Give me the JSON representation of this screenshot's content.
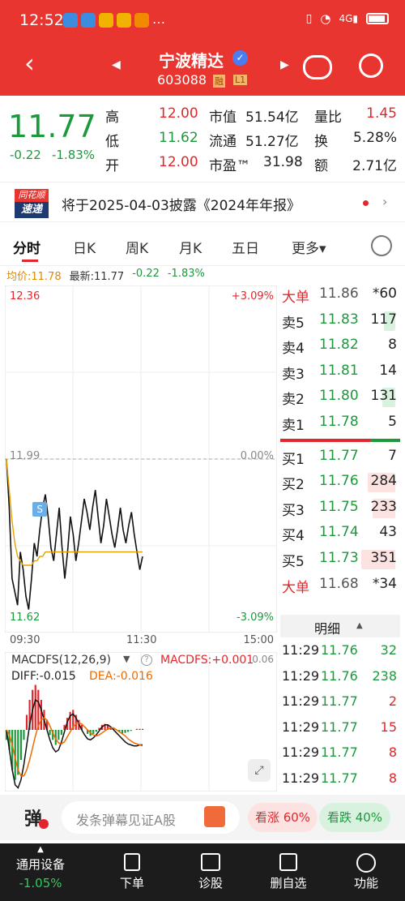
{
  "status": {
    "time": "12:52",
    "notif_icons": [
      "wechat-icon",
      "app-icon",
      "message-icon",
      "app2-icon",
      "app3-icon"
    ],
    "more": "…",
    "right_icons": [
      "vibrate-icon",
      "wifi-icon",
      "signal-4g-icon",
      "battery-icon"
    ]
  },
  "header": {
    "stock_name": "宁波精达",
    "verified_icon": "verified-check-icon",
    "stock_code": "603088",
    "badge_margin": "融",
    "badge_level": "L1",
    "back_icon": "back-arrow-icon",
    "prev_icon": "prev-stock-icon",
    "next_icon": "next-stock-icon",
    "robot_icon": "robot-icon",
    "search_icon": "search-icon"
  },
  "quote": {
    "price": "11.77",
    "change": "-0.22",
    "change_pct": "-1.83%",
    "labels": {
      "high": "高",
      "low": "低",
      "open": "开",
      "mkt_cap": "市值",
      "float_cap": "流通",
      "pe": "市盈™",
      "vol_ratio": "量比",
      "turnover": "换",
      "amount": "额"
    },
    "values": {
      "high": "12.00",
      "low": "11.62",
      "open": "12.00",
      "mkt_cap": "51.54亿",
      "float_cap": "51.27亿",
      "pe": "31.98",
      "vol_ratio": "1.45",
      "turnover": "5.28%",
      "amount": "2.71亿"
    }
  },
  "news": {
    "logo_top": "同花顺",
    "logo_bottom": "速递",
    "text": "将于2025-04-03披露《2024年年报》"
  },
  "tabs": [
    "分时",
    "日K",
    "周K",
    "月K",
    "五日",
    "更多▾"
  ],
  "tabs_active": 0,
  "chart_info": {
    "avg_label": "均价:11.78",
    "latest_label": "最新:11.77",
    "change": "-0.22",
    "change_pct": "-1.83%"
  },
  "chart_data": [
    {
      "type": "line",
      "title": "",
      "y_left_ticks": [
        "12.36",
        "11.99",
        "11.62"
      ],
      "y_right_ticks": [
        "+3.09%",
        "0.00%",
        "-3.09%"
      ],
      "x_ticks": [
        "09:30",
        "11:30",
        "15:00"
      ],
      "ylim": [
        11.62,
        12.36
      ],
      "reference": 11.99,
      "marker": "S",
      "series": [
        {
          "name": "",
          "values": [
            11.99,
            11.88,
            11.72,
            11.69,
            11.66,
            11.78,
            11.74,
            11.68,
            11.65,
            11.72,
            11.8,
            11.77,
            11.83,
            11.88,
            11.91,
            11.86,
            11.79,
            11.76,
            11.82,
            11.88,
            11.79,
            11.72,
            11.78,
            11.86,
            11.82,
            11.76,
            11.8,
            11.85,
            11.9,
            11.87,
            11.83,
            11.88,
            11.92,
            11.86,
            11.8,
            11.84,
            11.9,
            11.86,
            11.82,
            11.79,
            11.83,
            11.88,
            11.83,
            11.8,
            11.84,
            11.87,
            11.82,
            11.78,
            11.74,
            11.77
          ]
        },
        {
          "name": "",
          "values": [
            11.99,
            11.92,
            11.85,
            11.8,
            11.77,
            11.76,
            11.75,
            11.75,
            11.75,
            11.75,
            11.76,
            11.76,
            11.77,
            11.77,
            11.78,
            11.78,
            11.78,
            11.78,
            11.78,
            11.78,
            11.78,
            11.78,
            11.78,
            11.78,
            11.78,
            11.78,
            11.78,
            11.78,
            11.78,
            11.78,
            11.78,
            11.78,
            11.78,
            11.78,
            11.78,
            11.78,
            11.78,
            11.78,
            11.78,
            11.78,
            11.78,
            11.78,
            11.78,
            11.78,
            11.78,
            11.78,
            11.78,
            11.78,
            11.78,
            11.78
          ]
        }
      ]
    },
    {
      "type": "bar",
      "title": "MACDFS(12,26,9)",
      "ylim": [
        -0.06,
        0.06
      ],
      "right_tick": "0.06",
      "values": [
        -0.01,
        -0.02,
        -0.04,
        -0.05,
        -0.045,
        -0.03,
        -0.01,
        0.015,
        0.03,
        0.04,
        0.045,
        0.04,
        0.03,
        0.02,
        0.01,
        -0.005,
        -0.01,
        -0.015,
        -0.01,
        -0.005,
        0.005,
        0.012,
        0.018,
        0.02,
        0.015,
        0.01,
        0.005,
        0.0,
        -0.004,
        -0.006,
        -0.004,
        -0.002,
        0.002,
        0.005,
        0.006,
        0.005,
        0.003,
        0.001,
        0.0,
        -0.002,
        -0.004,
        -0.003,
        -0.002,
        -0.001,
        0.0,
        0.001,
        0.001,
        0.001
      ],
      "series": [
        {
          "name": "DIFF",
          "values": [
            0.0,
            -0.02,
            -0.04,
            -0.055,
            -0.058,
            -0.05,
            -0.035,
            -0.015,
            0.005,
            0.02,
            0.03,
            0.028,
            0.02,
            0.01,
            0.0,
            -0.01,
            -0.018,
            -0.022,
            -0.02,
            -0.012,
            -0.002,
            0.008,
            0.014,
            0.016,
            0.012,
            0.006,
            0.0,
            -0.005,
            -0.009,
            -0.01,
            -0.008,
            -0.005,
            -0.001,
            0.003,
            0.005,
            0.005,
            0.003,
            0.0,
            -0.003,
            -0.006,
            -0.009,
            -0.012,
            -0.014,
            -0.015,
            -0.016,
            -0.016,
            -0.015,
            -0.015
          ]
        },
        {
          "name": "DEA",
          "values": [
            0.0,
            -0.005,
            -0.015,
            -0.028,
            -0.04,
            -0.046,
            -0.046,
            -0.04,
            -0.03,
            -0.018,
            -0.006,
            0.004,
            0.01,
            0.012,
            0.01,
            0.004,
            -0.003,
            -0.009,
            -0.013,
            -0.014,
            -0.012,
            -0.007,
            -0.002,
            0.003,
            0.006,
            0.007,
            0.006,
            0.003,
            0.0,
            -0.003,
            -0.005,
            -0.006,
            -0.005,
            -0.003,
            -0.001,
            0.001,
            0.002,
            0.002,
            0.0,
            -0.002,
            -0.004,
            -0.006,
            -0.009,
            -0.011,
            -0.013,
            -0.014,
            -0.015,
            -0.016
          ]
        }
      ]
    }
  ],
  "macd": {
    "title": "MACDFS(12,26,9)",
    "macdfs_label": "MACDFS:+0.001",
    "diff_label": "DIFF:-0.015",
    "dea_label": "DEA:-0.016"
  },
  "orderbook": {
    "big_sell": {
      "label": "大单",
      "price": "11.86",
      "vol": "*60"
    },
    "asks": [
      {
        "label": "卖5",
        "price": "11.83",
        "vol": "117",
        "ratio": 0.33
      },
      {
        "label": "卖4",
        "price": "11.82",
        "vol": "8",
        "ratio": 0.0
      },
      {
        "label": "卖3",
        "price": "11.81",
        "vol": "14",
        "ratio": 0.0
      },
      {
        "label": "卖2",
        "price": "11.80",
        "vol": "131",
        "ratio": 0.37
      },
      {
        "label": "卖1",
        "price": "11.78",
        "vol": "5",
        "ratio": 0.0
      }
    ],
    "bids": [
      {
        "label": "买1",
        "price": "11.77",
        "vol": "7",
        "ratio": 0.0
      },
      {
        "label": "买2",
        "price": "11.76",
        "vol": "284",
        "ratio": 0.81
      },
      {
        "label": "买3",
        "price": "11.75",
        "vol": "233",
        "ratio": 0.66
      },
      {
        "label": "买4",
        "price": "11.74",
        "vol": "43",
        "ratio": 0.0
      },
      {
        "label": "买5",
        "price": "11.73",
        "vol": "351",
        "ratio": 1.0
      }
    ],
    "big_buy": {
      "label": "大单",
      "price": "11.68",
      "vol": "*34"
    }
  },
  "details": {
    "title": "明细",
    "rows": [
      {
        "time": "11:29",
        "price": "11.76",
        "vol": "32"
      },
      {
        "time": "11:29",
        "price": "11.76",
        "vol": "238"
      },
      {
        "time": "11:29",
        "price": "11.77",
        "vol": "2"
      },
      {
        "time": "11:29",
        "price": "11.77",
        "vol": "15"
      },
      {
        "time": "11:29",
        "price": "11.77",
        "vol": "8"
      },
      {
        "time": "11:29",
        "price": "11.77",
        "vol": "8"
      }
    ]
  },
  "danmu": {
    "icon_text": "弹",
    "placeholder": "发条弹幕见证A股",
    "up_label": "看涨 60%",
    "down_label": "看跌 40%",
    "up_pct": 60
  },
  "bottom": {
    "device_label": "通用设备",
    "device_change": "-1.05%",
    "order": "下单",
    "diagnose": "诊股",
    "remove_fav": "删自选",
    "functions": "功能"
  }
}
